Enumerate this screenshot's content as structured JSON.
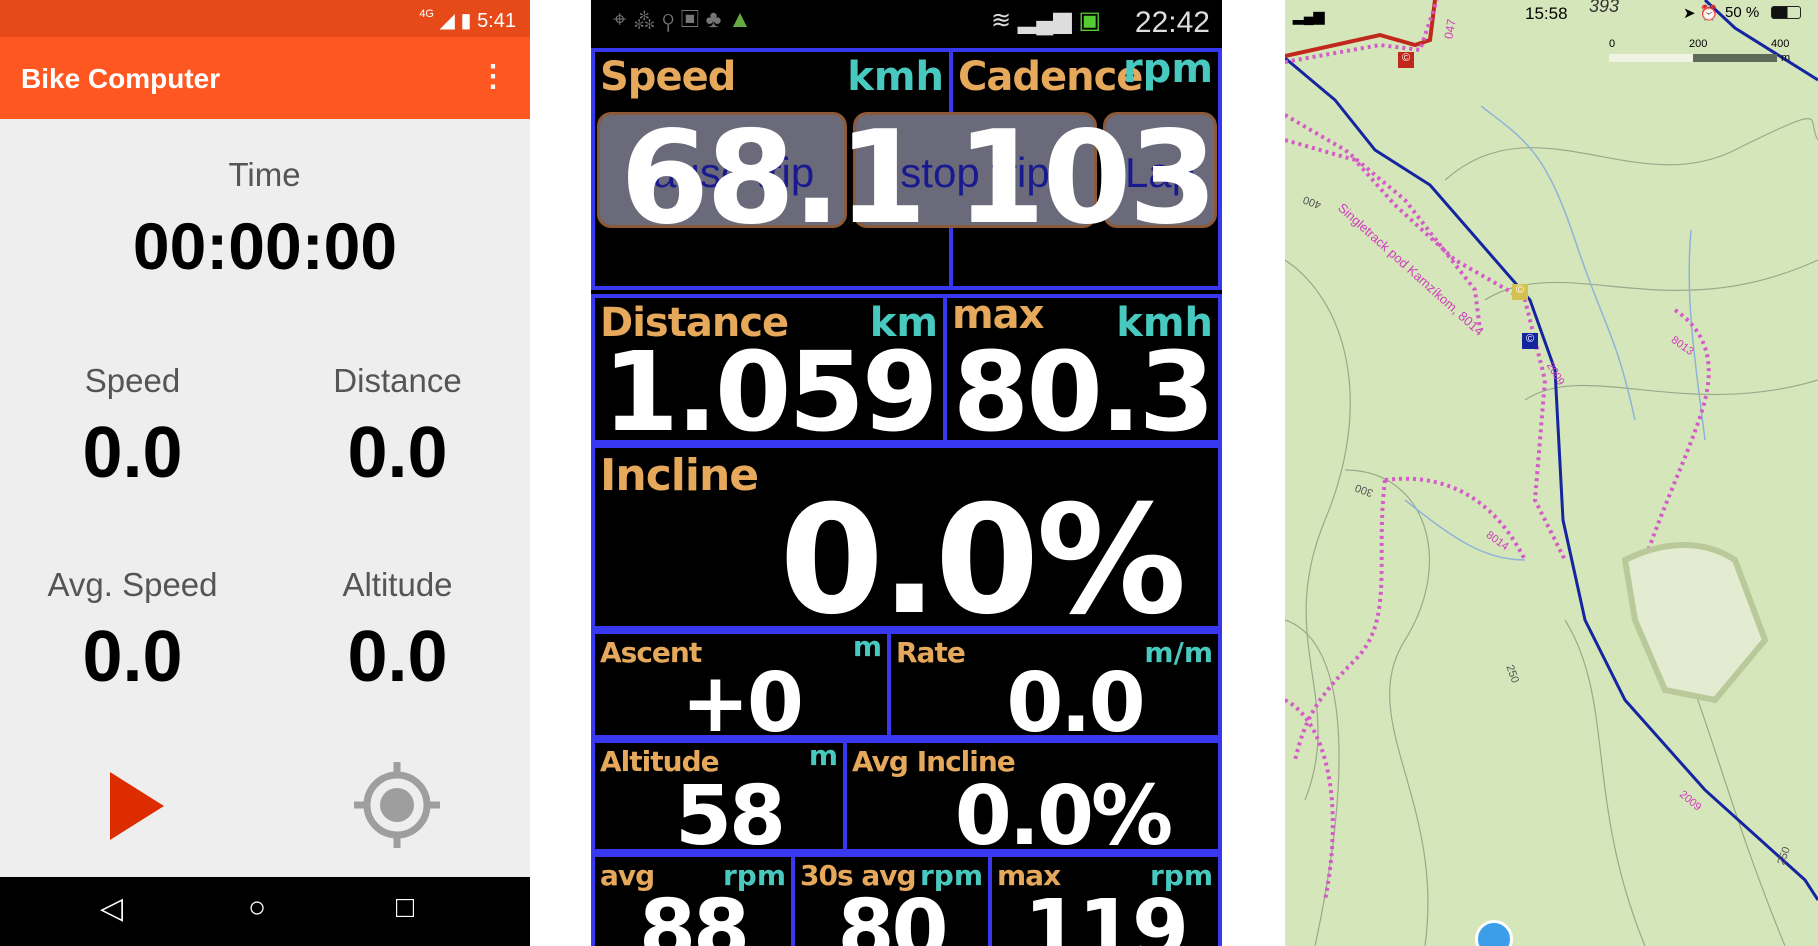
{
  "left_app": {
    "status_time": "5:41",
    "network": "4G",
    "title": "Bike Computer",
    "menu_icon": "more-vert-icon",
    "time_label": "Time",
    "time_value": "00:00:00",
    "stats": [
      {
        "label": "Speed",
        "value": "0.0"
      },
      {
        "label": "Distance",
        "value": "0.0"
      },
      {
        "label": "Avg. Speed",
        "value": "0.0"
      },
      {
        "label": "Altitude",
        "value": "0.0"
      }
    ],
    "colors": {
      "appbar": "#ff5722",
      "statusbar": "#e64a19",
      "play": "#dd2c00"
    }
  },
  "mid_app": {
    "status_time": "22:42",
    "speed": {
      "label": "Speed",
      "unit": "kmh",
      "value": "68.1"
    },
    "cadence": {
      "label": "Cadence",
      "unit": "rpm",
      "value": "103"
    },
    "buttons": [
      "pause trip",
      "stop trip",
      "Lap"
    ],
    "distance": {
      "label": "Distance",
      "unit": "km",
      "value": "1.059"
    },
    "max_speed": {
      "label": "max",
      "unit": "kmh",
      "value": "80.3"
    },
    "incline": {
      "label": "Incline",
      "value": "0.0%"
    },
    "ascent": {
      "label": "Ascent",
      "unit": "m",
      "value": "+0"
    },
    "rate": {
      "label": "Rate",
      "unit": "m/m",
      "value": "0.0"
    },
    "altitude": {
      "label": "Altitude",
      "unit": "m",
      "value": "58"
    },
    "avg_incline": {
      "label": "Avg Incline",
      "value": "0.0%"
    },
    "avg_cad": {
      "label": "avg",
      "unit": "rpm",
      "value": "88"
    },
    "avg30_cad": {
      "label": "30s avg",
      "unit": "rpm",
      "value": "80"
    },
    "max_cad": {
      "label": "max",
      "unit": "rpm",
      "value": "119"
    },
    "colors": {
      "border": "#3838f0",
      "label": "#e6a85a",
      "unit": "#48c9c0"
    }
  },
  "map_app": {
    "status_time": "15:58",
    "battery": "50 %",
    "peak": "393",
    "scale": {
      "ticks": [
        "0",
        "200",
        "400"
      ],
      "unit": "m"
    },
    "labels": {
      "trail": "Singletrack pod Kamzíkom, 8014",
      "t047": "047",
      "t2009a": "2009",
      "t2009b": "2009",
      "t8013": "8013",
      "t8014": "8014",
      "c400": "400",
      "c300": "300",
      "c250a": "250",
      "c250b": "250"
    }
  }
}
